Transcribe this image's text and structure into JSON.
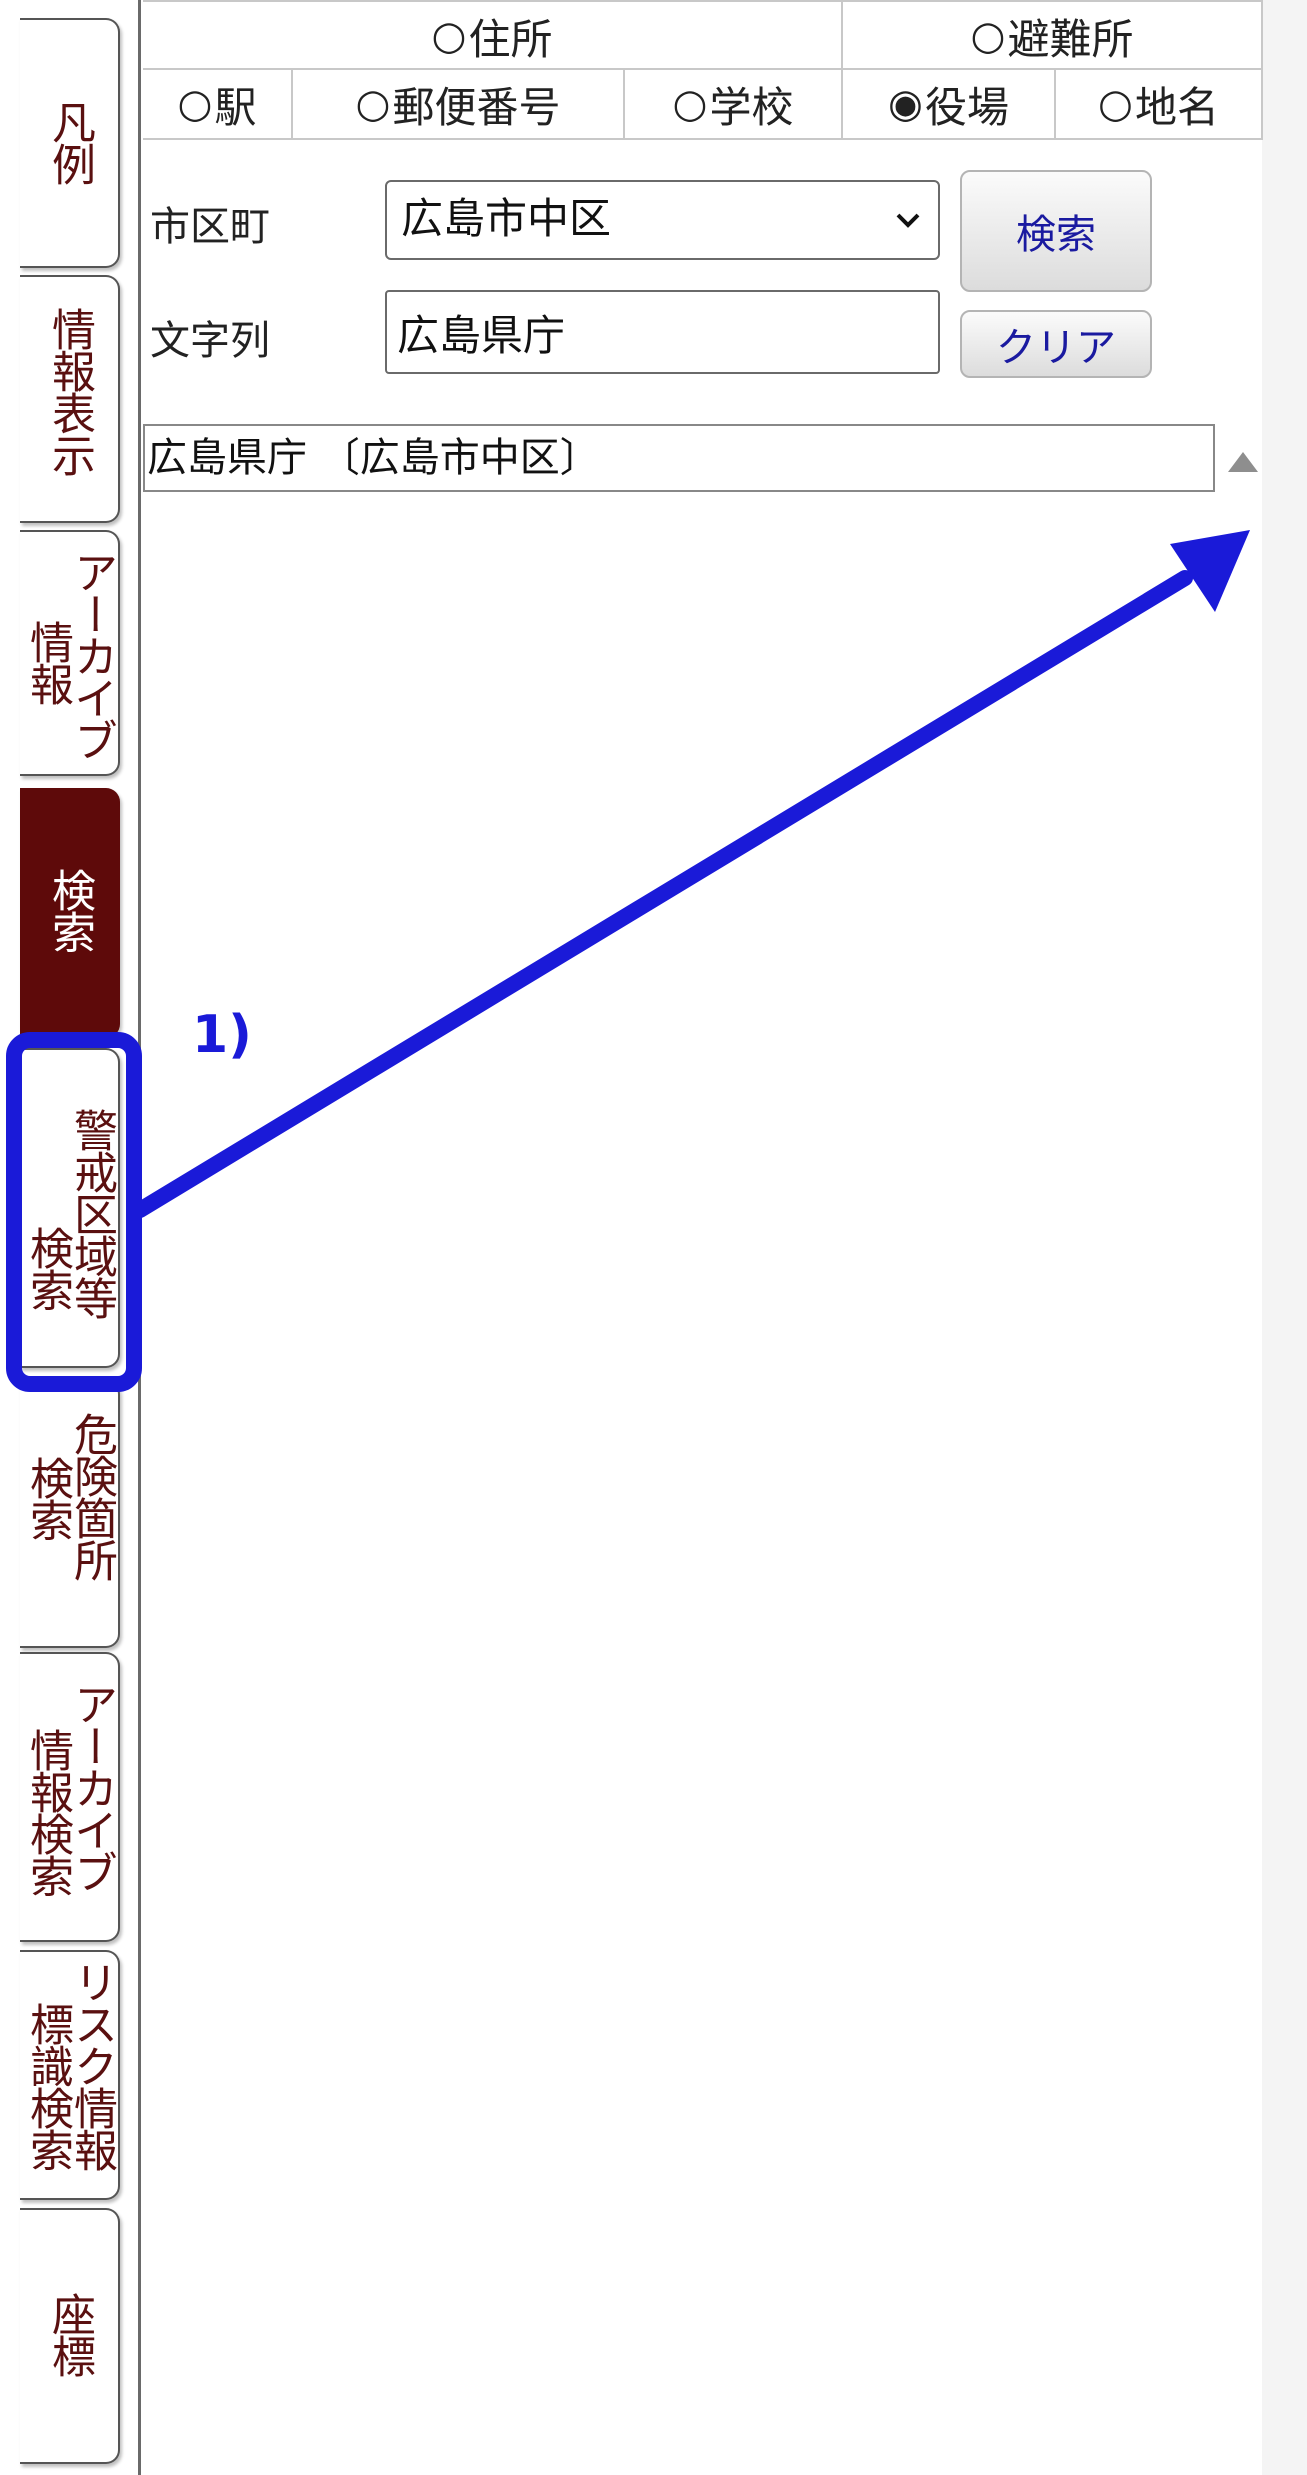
{
  "search_types": {
    "row1": [
      {
        "label": "住所",
        "selected": false
      },
      {
        "label": "避難所",
        "selected": false
      }
    ],
    "row2": [
      {
        "label": "駅",
        "selected": false
      },
      {
        "label": "郵便番号",
        "selected": false
      },
      {
        "label": "学校",
        "selected": false
      },
      {
        "label": "役場",
        "selected": true
      },
      {
        "label": "地名",
        "selected": false
      }
    ],
    "radio_off": "○",
    "radio_on": "◉"
  },
  "form": {
    "city_label": "市区町",
    "city_value": "広島市中区",
    "text_label": "文字列",
    "text_value": "広島県庁",
    "search_button": "検索",
    "clear_button": "クリア"
  },
  "results": [
    "広島県庁 〔広島市中区〕"
  ],
  "tabs": [
    {
      "id": "legend",
      "col1": "凡例",
      "col2": ""
    },
    {
      "id": "info",
      "col1": "情報表示",
      "col2": ""
    },
    {
      "id": "archive",
      "col1": "アーカイブ",
      "col2": "情報"
    },
    {
      "id": "search",
      "col1": "検索",
      "col2": "",
      "active": true
    },
    {
      "id": "warning",
      "col1": "警戒区域等",
      "col2": "検索"
    },
    {
      "id": "danger",
      "col1": "危険箇所",
      "col2": "検索"
    },
    {
      "id": "archive-search",
      "col1": "アーカイブ",
      "col2": "情報検索"
    },
    {
      "id": "risk",
      "col1": "リスク情報",
      "col2": "標識検索"
    },
    {
      "id": "coord",
      "col1": "座標",
      "col2": ""
    }
  ],
  "annotation": {
    "label": "1)",
    "color": "#1a1ad8"
  },
  "colors": {
    "active_tab": "#5e0a0a",
    "tab_text": "#5a1010",
    "button_text": "#1a1aa0"
  }
}
